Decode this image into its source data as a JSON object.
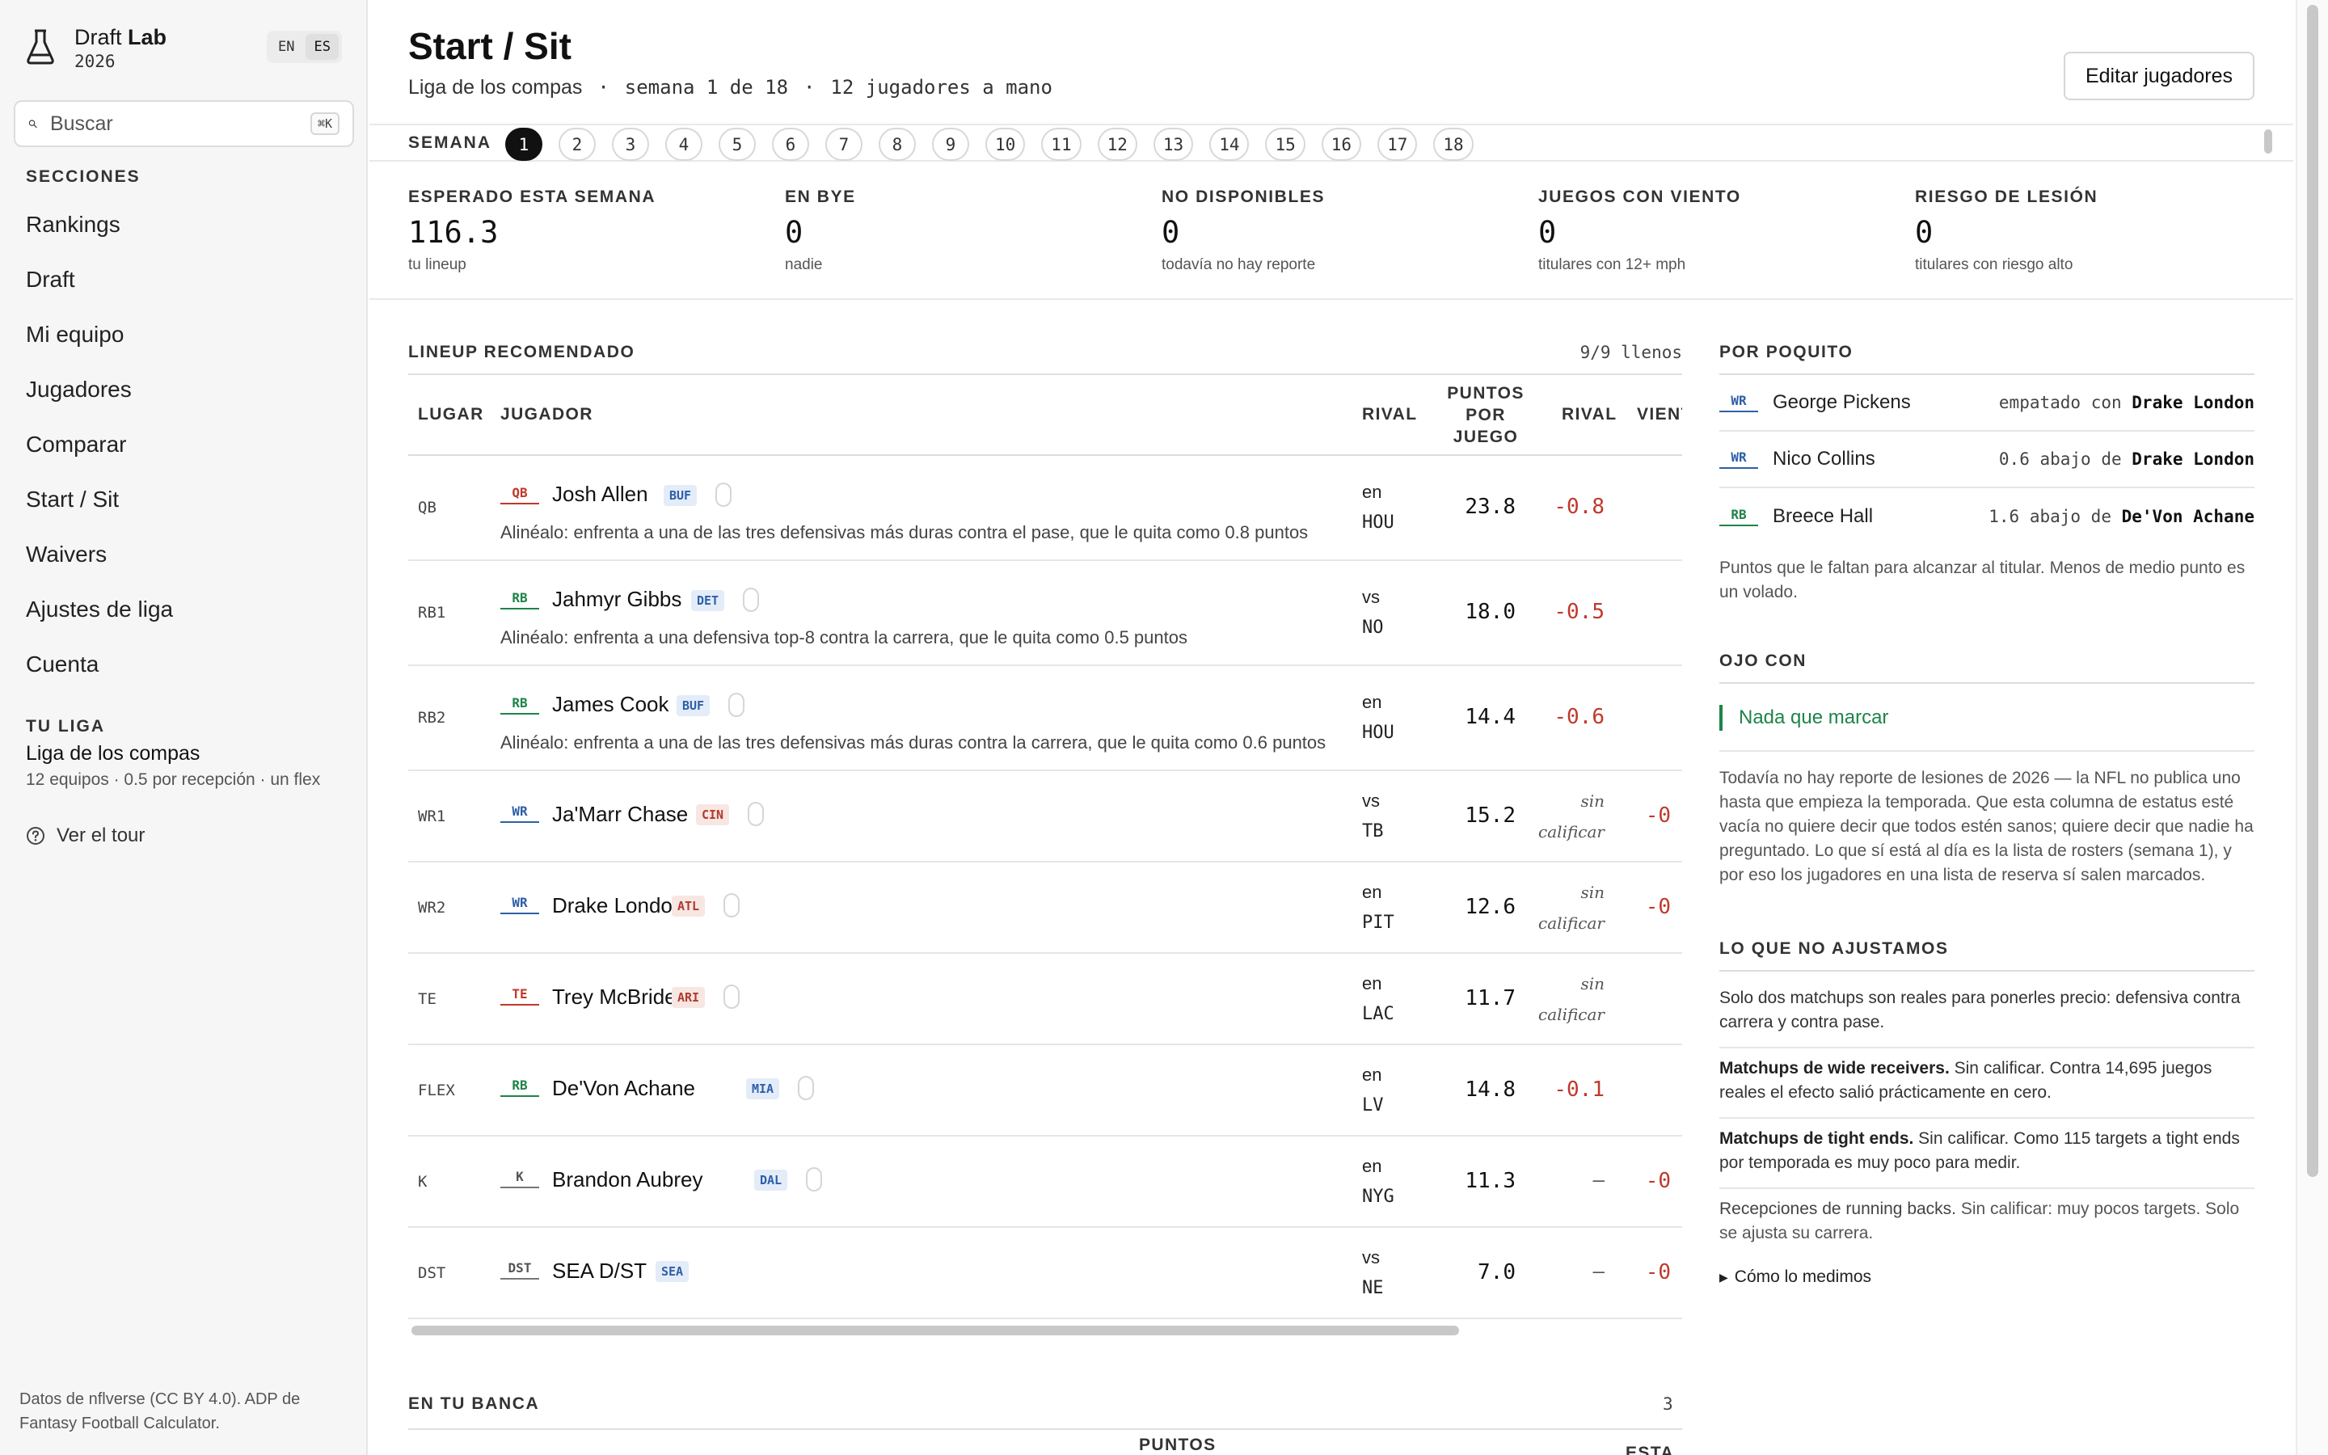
{
  "brand": {
    "name_light": "Draft",
    "name_bold": "Lab",
    "year": "2026",
    "lang_en": "EN",
    "lang_es": "ES"
  },
  "search": {
    "placeholder": "Buscar",
    "shortcut": "⌘K"
  },
  "sidebar": {
    "section_title": "SECCIONES",
    "items": [
      {
        "label": "Rankings"
      },
      {
        "label": "Draft"
      },
      {
        "label": "Mi equipo"
      },
      {
        "label": "Jugadores"
      },
      {
        "label": "Comparar"
      },
      {
        "label": "Start / Sit"
      },
      {
        "label": "Waivers"
      },
      {
        "label": "Ajustes de liga"
      },
      {
        "label": "Cuenta"
      }
    ],
    "league_title": "TU LIGA",
    "league_name": "Liga de los compas",
    "league_meta": "12 equipos · 0.5 por recepción · un flex",
    "tour": "Ver el tour",
    "footer": "Datos de nflverse (CC BY 4.0). ADP de Fantasy Football Calculator."
  },
  "header": {
    "title": "Start / Sit",
    "league": "Liga de los compas",
    "sep": "·",
    "week_info": "semana 1 de 18",
    "players_info": "12 jugadores a mano",
    "edit_button": "Editar jugadores"
  },
  "weeks": {
    "label": "SEMANA",
    "items": [
      "1",
      "2",
      "3",
      "4",
      "5",
      "6",
      "7",
      "8",
      "9",
      "10",
      "11",
      "12",
      "13",
      "14",
      "15",
      "16",
      "17",
      "18"
    ],
    "active": "1"
  },
  "stats": [
    {
      "label": "ESPERADO ESTA SEMANA",
      "value": "116.3",
      "note": "tu lineup"
    },
    {
      "label": "EN BYE",
      "value": "0",
      "note": "nadie"
    },
    {
      "label": "NO DISPONIBLES",
      "value": "0",
      "note": "todavía no hay reporte"
    },
    {
      "label": "JUEGOS CON VIENTO",
      "value": "0",
      "note": "titulares con 12+ mph"
    },
    {
      "label": "RIESGO DE LESIÓN",
      "value": "0",
      "note": "titulares con riesgo alto"
    }
  ],
  "lineup": {
    "title": "LINEUP RECOMENDADO",
    "count": "9/9 llenos",
    "columns": {
      "slot": "LUGAR",
      "player": "JUGADOR",
      "rival": "RIVAL",
      "puntos_1": "PUNTOS",
      "puntos_2": "POR",
      "puntos_3": "JUEGO",
      "rival2": "RIVAL",
      "viento": "VIENT"
    },
    "rows": [
      {
        "slot": "QB",
        "pos": "QB",
        "name": "Josh Allen",
        "team": "BUF",
        "advice": "Aliné­alo: enfrenta a una de las tres defensivas más duras contra el pase, que le quita como 0.8 puntos",
        "rival_pre": "en",
        "rival_team": "HOU",
        "pts": "23.8",
        "delta": "-0.8",
        "viento": ""
      },
      {
        "slot": "RB1",
        "pos": "RB",
        "name": "Jahmyr Gibbs",
        "team": "DET",
        "advice": "Alinéalo: enfrenta a una defensiva top-8 contra la carrera, que le quita como 0.5 puntos",
        "rival_pre": "vs",
        "rival_team": "NO",
        "pts": "18.0",
        "delta": "-0.5",
        "viento": ""
      },
      {
        "slot": "RB2",
        "pos": "RB",
        "name": "James Cook",
        "team": "BUF",
        "advice": "Alinéalo: enfrenta a una de las tres defensivas más duras contra la carrera, que le quita como 0.6 puntos",
        "rival_pre": "en",
        "rival_team": "HOU",
        "pts": "14.4",
        "delta": "-0.6",
        "viento": ""
      },
      {
        "slot": "WR1",
        "pos": "WR",
        "name": "Ja'Marr Chase",
        "team": "CIN",
        "advice": "",
        "rival_pre": "vs",
        "rival_team": "TB",
        "pts": "15.2",
        "delta_1": "sin",
        "delta_2": "calificar",
        "viento": "-0"
      },
      {
        "slot": "WR2",
        "pos": "WR",
        "name": "Drake London",
        "team": "ATL",
        "advice": "",
        "rival_pre": "en",
        "rival_team": "PIT",
        "pts": "12.6",
        "delta_1": "sin",
        "delta_2": "calificar",
        "viento": "-0"
      },
      {
        "slot": "TE",
        "pos": "TE",
        "name": "Trey McBride",
        "team": "ARI",
        "advice": "",
        "rival_pre": "en",
        "rival_team": "LAC",
        "pts": "11.7",
        "delta_1": "sin",
        "delta_2": "calificar",
        "viento": ""
      },
      {
        "slot": "FLEX",
        "pos": "RB",
        "name": "De'Von Achane",
        "team": "MIA",
        "advice": "",
        "rival_pre": "en",
        "rival_team": "LV",
        "pts": "14.8",
        "delta": "-0.1",
        "viento": ""
      },
      {
        "slot": "K",
        "pos": "K",
        "name": "Brandon Aubrey",
        "team": "DAL",
        "advice": "",
        "rival_pre": "en",
        "rival_team": "NYG",
        "pts": "11.3",
        "delta": "—",
        "viento": "-0"
      },
      {
        "slot": "DST",
        "pos": "DST",
        "name": "SEA D/ST",
        "team": "SEA",
        "advice": "",
        "rival_pre": "vs",
        "rival_team": "NE",
        "pts": "7.0",
        "delta": "—",
        "viento": "-0"
      }
    ]
  },
  "bench": {
    "title": "EN TU BANCA",
    "count": "3",
    "col_puntos": "PUNTOS",
    "col_esta": "ESTA"
  },
  "close_calls": {
    "title": "POR POQUITO",
    "rows": [
      {
        "pos": "WR",
        "name": "George Pickens",
        "text": "empatado con",
        "vs": "Drake London"
      },
      {
        "pos": "WR",
        "name": "Nico Collins",
        "text": "0.6 abajo de",
        "vs": "Drake London"
      },
      {
        "pos": "RB",
        "name": "Breece Hall",
        "text": "1.6 abajo de",
        "vs": "De'Von Achane"
      }
    ],
    "note": "Puntos que le faltan para alcanzar al titular. Menos de medio punto es un volado."
  },
  "watch": {
    "title": "OJO CON",
    "flag": "Nada que marcar",
    "para": "Todavía no hay reporte de lesiones de 2026 — la NFL no publica uno hasta que empieza la temporada. Que esta columna de estatus esté vacía no quiere decir que todos estén sanos; quiere decir que nadie ha preguntado. Lo que sí está al día es la lista de rosters (semana 1), y por eso los jugadores en una lista de reserva sí salen marcados."
  },
  "not_adjusted": {
    "title": "LO QUE NO AJUSTAMOS",
    "intro": "Solo dos matchups son reales para ponerles precio: defensiva contra carrera y contra pase.",
    "items": [
      {
        "bold": "Matchups de wide receivers.",
        "text": " Sin calificar. Contra 14,695 juegos reales el efecto salió prácticamente en cero."
      },
      {
        "bold": "Matchups de tight ends.",
        "text": " Sin calificar. Como 115 targets a tight ends por temporada es muy poco para medir."
      },
      {
        "bold": "Recepciones de running backs.",
        "text": " Sin calificar: muy pocos targets. Solo se ajusta su carrera."
      }
    ],
    "details": "Cómo lo medimos"
  },
  "colors": {
    "accent_green": "#1e8449",
    "negative_red": "#c0392b",
    "wr_blue": "#2e5fa8"
  }
}
